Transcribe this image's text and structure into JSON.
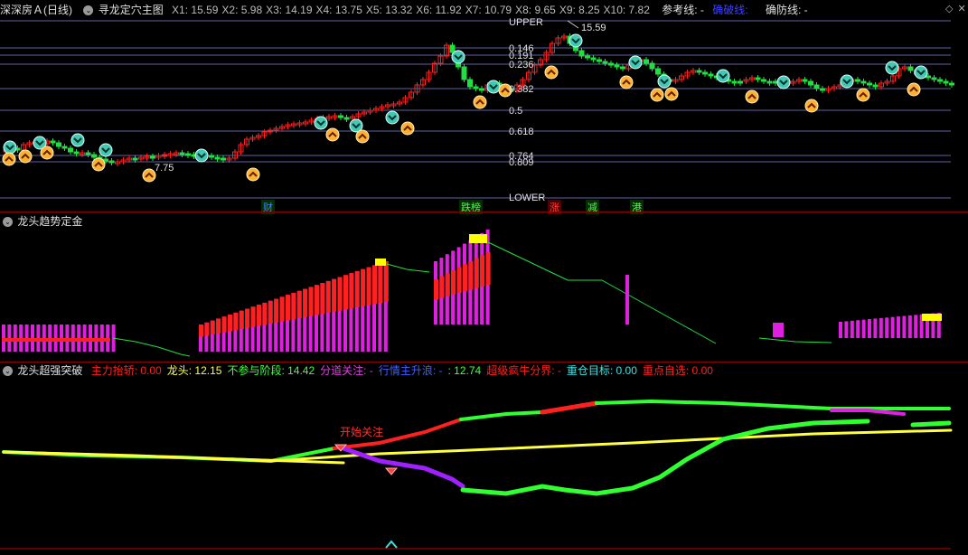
{
  "colors": {
    "bg": "#000000",
    "up": "#ff2020",
    "down": "#20e040",
    "magenta": "#e020e0",
    "yellow": "#ffff00",
    "cyan": "#40e0e0",
    "purple": "#9020ff",
    "grid": "#6060a0"
  },
  "main": {
    "stock_name": "深深房Ａ(日线)",
    "indicator_name": "寻龙定穴主图",
    "xlabels": [
      {
        "k": "X1",
        "v": "15.59"
      },
      {
        "k": "X2",
        "v": "5.98"
      },
      {
        "k": "X3",
        "v": "14.19"
      },
      {
        "k": "X4",
        "v": "13.75"
      },
      {
        "k": "X5",
        "v": "13.32"
      },
      {
        "k": "X6",
        "v": "11.92"
      },
      {
        "k": "X7",
        "v": "10.79"
      },
      {
        "k": "X8",
        "v": "9.65"
      },
      {
        "k": "X9",
        "v": "8.25"
      },
      {
        "k": "X10",
        "v": "7.82"
      }
    ],
    "ref_line_label": "参考线: -",
    "breakout_label": "确破线:",
    "confirm_label": "确防线: -",
    "upper_label": "UPPER",
    "lower_label": "LOWER",
    "fib_levels": [
      "0.146",
      "0.191",
      "0.236",
      "0.382",
      "0.5",
      "0.618",
      "0.764",
      "0.809"
    ],
    "high_price": "15.59",
    "low_price": "7.75",
    "event_markers": [
      {
        "text": "财",
        "color": "#4080ff"
      },
      {
        "text": "跌榜",
        "color": "#40ff40"
      },
      {
        "text": "涨",
        "color": "#ff4040"
      },
      {
        "text": "减",
        "color": "#40ff40"
      },
      {
        "text": "港",
        "color": "#40ff40"
      }
    ]
  },
  "panel2": {
    "title": "龙头趋势定金"
  },
  "panel3": {
    "title": "龙头超强突破",
    "items": [
      {
        "label": "主力抬轿: 0.00",
        "color": "#ff2020"
      },
      {
        "label": "龙头: 12.15",
        "color": "#ffff40"
      },
      {
        "label": "不参与阶段: 14.42",
        "color": "#40ff40"
      },
      {
        "label": "分道关注: -",
        "color": "#e040e0"
      },
      {
        "label": "行情主升浪: -",
        "color": "#4060ff"
      },
      {
        "label": ": 12.74",
        "color": "#40ff40"
      },
      {
        "label": "超级疯牛分界: -",
        "color": "#ff2020"
      },
      {
        "label": "重仓目标: 0.00",
        "color": "#40e0e0"
      },
      {
        "label": "重点自选: 0.00",
        "color": "#ff2020"
      }
    ],
    "annotation": "开始关注"
  }
}
